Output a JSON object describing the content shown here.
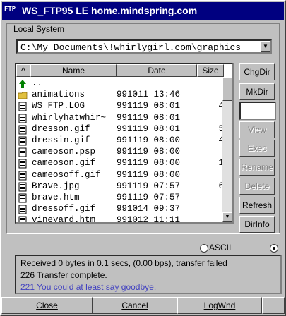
{
  "window": {
    "title": "WS_FTP95 LE home.mindspring.com",
    "app_icon_text": "FTP"
  },
  "local": {
    "group_label": "Local System",
    "path": "C:\\My Documents\\!whirlygirl.com\\graphics",
    "columns": [
      "^",
      "Name",
      "Date",
      "Size"
    ],
    "files": [
      {
        "icon": "up-arrow-icon",
        "name": "..",
        "date": "",
        "size": ""
      },
      {
        "icon": "folder-icon",
        "name": "animations",
        "date": "991011 13:46",
        "size": ""
      },
      {
        "icon": "file-icon",
        "name": "WS_FTP.LOG",
        "date": "991119 08:01",
        "size": "4"
      },
      {
        "icon": "file-icon",
        "name": "whirlyhatwhir~",
        "date": "991119 08:01",
        "size": ""
      },
      {
        "icon": "file-icon",
        "name": "dresson.gif",
        "date": "991119 08:01",
        "size": "5"
      },
      {
        "icon": "file-icon",
        "name": "dressin.gif",
        "date": "991119 08:00",
        "size": "4"
      },
      {
        "icon": "file-icon",
        "name": "cameoson.psp",
        "date": "991119 08:00",
        "size": ""
      },
      {
        "icon": "file-icon",
        "name": "cameoson.gif",
        "date": "991119 08:00",
        "size": "1"
      },
      {
        "icon": "file-icon",
        "name": "cameosoff.gif",
        "date": "991119 08:00",
        "size": ""
      },
      {
        "icon": "file-icon",
        "name": "Brave.jpg",
        "date": "991119 07:57",
        "size": "6"
      },
      {
        "icon": "file-icon",
        "name": "brave.htm",
        "date": "991119 07:57",
        "size": ""
      },
      {
        "icon": "file-icon",
        "name": "dressoff.gif",
        "date": "991014 09:37",
        "size": ""
      },
      {
        "icon": "file-icon",
        "name": "vineyard.htm",
        "date": "991012 11:11",
        "size": ""
      }
    ],
    "buttons": [
      {
        "label": "ChgDir",
        "enabled": true
      },
      {
        "label": "MkDir",
        "enabled": true
      },
      {
        "label": "View",
        "enabled": false
      },
      {
        "label": "Exec",
        "enabled": false
      },
      {
        "label": "Rename",
        "enabled": false
      },
      {
        "label": "Delete",
        "enabled": false
      },
      {
        "label": "Refresh",
        "enabled": true
      },
      {
        "label": "DirInfo",
        "enabled": true
      }
    ]
  },
  "transfer_mode": {
    "ascii_label": "ASCII",
    "selected": "other"
  },
  "status_log": [
    {
      "text": "Received 0 bytes in 0.1 secs, (0.00 bps), transfer failed",
      "color": "#000000"
    },
    {
      "text": "226 Transfer complete.",
      "color": "#000000"
    },
    {
      "text": "221 You could at least say goodbye.",
      "color": "#4040c0"
    }
  ],
  "bottom_buttons": [
    {
      "label": "Close"
    },
    {
      "label": "Cancel"
    },
    {
      "label": "LogWnd"
    }
  ]
}
